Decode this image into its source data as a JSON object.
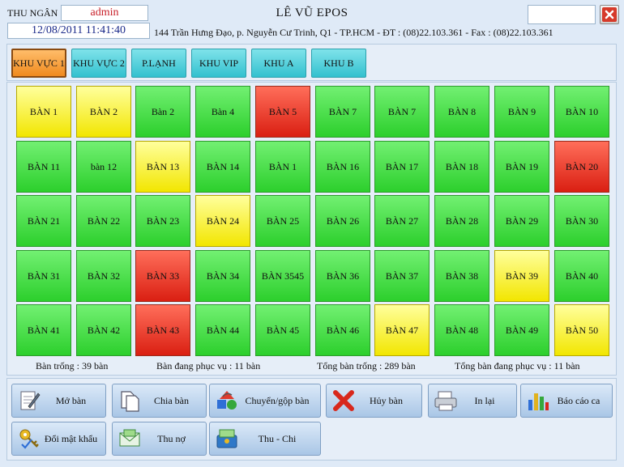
{
  "header": {
    "cashier_label": "THU NGÂN",
    "cashier_name": "admin",
    "datetime": "12/08/2011 11:41:40",
    "store_name": "LÊ VŨ EPOS",
    "address": "144 Trần Hưng Đạo,  p. Nguyễn Cư Trinh,  Q1 - TP.HCM - ĐT : (08)22.103.361  - Fax : (08)22.103.361"
  },
  "areas": [
    {
      "label": "KHU VỰC 1",
      "active": true
    },
    {
      "label": "KHU VỰC 2",
      "active": false
    },
    {
      "label": "P.LẠNH",
      "active": false
    },
    {
      "label": "KHU VIP",
      "active": false
    },
    {
      "label": "KHU A",
      "active": false
    },
    {
      "label": "KHU B",
      "active": false
    }
  ],
  "status_colors": {
    "empty": "#2ccf2c",
    "serving": "#f2e600",
    "alert": "#da1f12"
  },
  "tables": [
    {
      "label": "BÀN 1",
      "status": "yellow"
    },
    {
      "label": "BÀN 2",
      "status": "yellow"
    },
    {
      "label": "Bàn 2",
      "status": "green"
    },
    {
      "label": "Bàn 4",
      "status": "green"
    },
    {
      "label": "BÀN 5",
      "status": "red"
    },
    {
      "label": "BÀN 7",
      "status": "green"
    },
    {
      "label": "BÀN 7",
      "status": "green"
    },
    {
      "label": "BÀN 8",
      "status": "green"
    },
    {
      "label": "BÀN 9",
      "status": "green"
    },
    {
      "label": "BÀN 10",
      "status": "green"
    },
    {
      "label": "BÀN 11",
      "status": "green"
    },
    {
      "label": "bàn 12",
      "status": "green"
    },
    {
      "label": "BÀN 13",
      "status": "yellow"
    },
    {
      "label": "BÀN 14",
      "status": "green"
    },
    {
      "label": "BÀN 1",
      "status": "green"
    },
    {
      "label": "BÀN 16",
      "status": "green"
    },
    {
      "label": "BÀN 17",
      "status": "green"
    },
    {
      "label": "BÀN 18",
      "status": "green"
    },
    {
      "label": "BÀN 19",
      "status": "green"
    },
    {
      "label": "BÀN 20",
      "status": "red"
    },
    {
      "label": "BÀN 21",
      "status": "green"
    },
    {
      "label": "BÀN 22",
      "status": "green"
    },
    {
      "label": "BÀN 23",
      "status": "green"
    },
    {
      "label": "BÀN 24",
      "status": "yellow"
    },
    {
      "label": "BÀN 25",
      "status": "green"
    },
    {
      "label": "BÀN 26",
      "status": "green"
    },
    {
      "label": "BÀN 27",
      "status": "green"
    },
    {
      "label": "BÀN 28",
      "status": "green"
    },
    {
      "label": "BÀN 29",
      "status": "green"
    },
    {
      "label": "BÀN 30",
      "status": "green"
    },
    {
      "label": "BÀN 31",
      "status": "green"
    },
    {
      "label": "BÀN 32",
      "status": "green"
    },
    {
      "label": "BÀN 33",
      "status": "red"
    },
    {
      "label": "BÀN 34",
      "status": "green"
    },
    {
      "label": "BÀN 3545",
      "status": "green"
    },
    {
      "label": "BÀN 36",
      "status": "green"
    },
    {
      "label": "BÀN 37",
      "status": "green"
    },
    {
      "label": "BÀN 38",
      "status": "green"
    },
    {
      "label": "BÀN 39",
      "status": "yellow"
    },
    {
      "label": "BÀN 40",
      "status": "green"
    },
    {
      "label": "BÀN 41",
      "status": "green"
    },
    {
      "label": "BÀN 42",
      "status": "green"
    },
    {
      "label": "BÀN 43",
      "status": "red"
    },
    {
      "label": "BÀN 44",
      "status": "green"
    },
    {
      "label": "BÀN 45",
      "status": "green"
    },
    {
      "label": "BÀN 46",
      "status": "green"
    },
    {
      "label": "BÀN 47",
      "status": "yellow"
    },
    {
      "label": "BÀN 48",
      "status": "green"
    },
    {
      "label": "BÀN 49",
      "status": "green"
    },
    {
      "label": "BÀN 50",
      "status": "yellow"
    }
  ],
  "stats": {
    "empty_tables": "Bàn trống : 39 bàn",
    "serving_tables": "Bàn đang phục vụ : 11 bàn",
    "total_empty": "Tổng bàn trống : 289 bàn",
    "total_serving": "Tổng bàn đang phục vụ : 11 bàn"
  },
  "actions": [
    {
      "label": "Mở bàn",
      "icon": "notepad-pen-icon"
    },
    {
      "label": "Chia bàn",
      "icon": "documents-icon"
    },
    {
      "label": "Chuyển/gộp bàn",
      "icon": "recycle-shapes-icon"
    },
    {
      "label": "Hủy bàn",
      "icon": "red-x-icon"
    },
    {
      "label": "In lại",
      "icon": "printer-icon"
    },
    {
      "label": "Báo cáo ca",
      "icon": "bar-chart-icon"
    },
    {
      "label": "Đổi mật khẩu",
      "icon": "keys-icon"
    },
    {
      "label": "Thu nợ",
      "icon": "money-envelope-icon"
    },
    {
      "label": "Thu - Chi",
      "icon": "money-box-icon"
    }
  ]
}
